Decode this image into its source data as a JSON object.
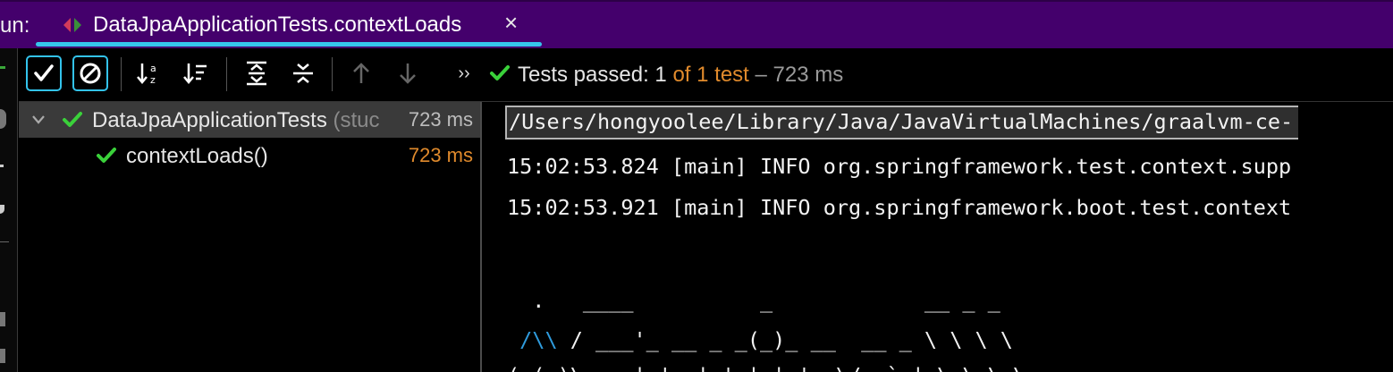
{
  "tabbar": {
    "run_label": "un:",
    "tab_title": "DataJpaApplicationTests.contextLoads",
    "close_glyph": "×"
  },
  "toolbar": {
    "buttons": [
      {
        "name": "show-passed-icon",
        "toggled": true
      },
      {
        "name": "show-ignored-icon",
        "toggled": true
      },
      {
        "name": "sort-alphabetically-icon",
        "toggled": false
      },
      {
        "name": "sort-by-duration-icon",
        "toggled": false
      },
      {
        "name": "expand-all-icon",
        "toggled": false
      },
      {
        "name": "collapse-all-icon",
        "toggled": false
      },
      {
        "name": "previous-failed-icon",
        "toggled": false
      },
      {
        "name": "next-failed-icon",
        "toggled": false
      },
      {
        "name": "more-icon",
        "toggled": false
      }
    ],
    "more_glyph": "››"
  },
  "status": {
    "label": "Tests passed:",
    "passed": "1",
    "of_total": "of 1 test",
    "duration": "– 723 ms",
    "color_passed": "#3ad13a",
    "color_highlight": "#e08a2c"
  },
  "tree": {
    "rows": [
      {
        "label": "DataJpaApplicationTests",
        "hint": "(stuc",
        "time": "723 ms",
        "status": "passed",
        "expanded": true
      },
      {
        "label": "contextLoads()",
        "hint": "",
        "time": "723 ms",
        "status": "passed"
      }
    ]
  },
  "console": {
    "lines": [
      "/Users/hongyoolee/Library/Java/JavaVirtualMachines/graalvm-ce-",
      "15:02:53.824 [main] INFO org.springframework.test.context.supp",
      "15:02:53.921 [main] INFO org.springframework.boot.test.context",
      "",
      "  .   ____          _            __ _ _",
      " /\\\\ / ___'_ __ _ _(_)_ __  __ _ \\ \\ \\ \\",
      "( ( )\\___ | '_ | '_| | '_ \\/ _` | \\ \\ \\ \\"
    ],
    "banner_blue": "/\\\\",
    "banner_rest": " / ___'_ __ _ _(_)_ __  __ _ \\ \\ \\ \\"
  }
}
